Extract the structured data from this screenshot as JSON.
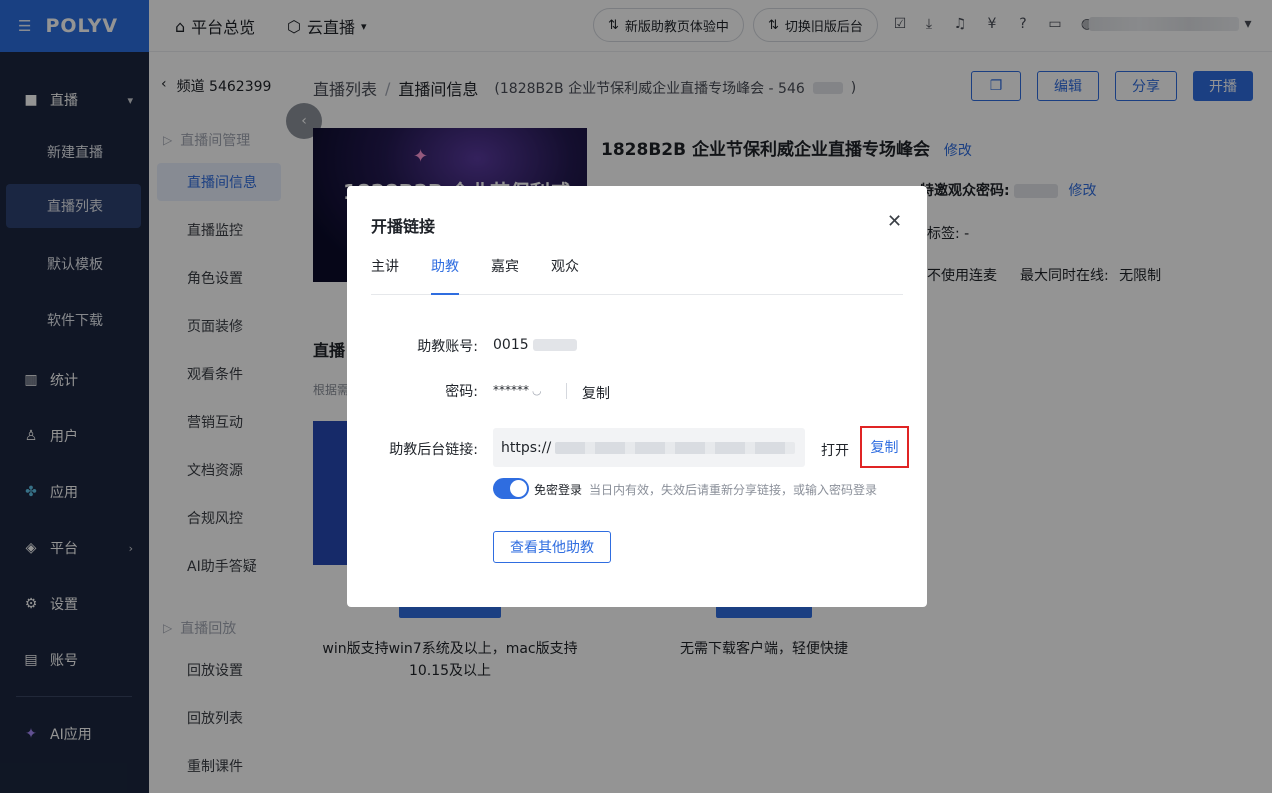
{
  "nav": {
    "logo": "POLYV",
    "items": [
      {
        "label": "直播",
        "icon": "video-icon"
      },
      {
        "label": "统计",
        "icon": "bar-chart-icon"
      },
      {
        "label": "用户",
        "icon": "user-icon"
      },
      {
        "label": "应用",
        "icon": "apps-icon"
      },
      {
        "label": "平台",
        "icon": "layers-icon"
      },
      {
        "label": "设置",
        "icon": "gear-icon"
      },
      {
        "label": "账号",
        "icon": "id-card-icon"
      },
      {
        "label": "AI应用",
        "icon": "sparkle-icon"
      }
    ],
    "sub_items": [
      "新建直播",
      "直播列表",
      "默认模板",
      "软件下载"
    ],
    "active_sub": "直播列表"
  },
  "subnav": {
    "channel": "频道 5462399",
    "group1": "直播间管理",
    "group1_items": [
      "直播间信息",
      "直播监控",
      "角色设置",
      "页面装修",
      "观看条件",
      "营销互动",
      "文档资源",
      "合规风控",
      "AI助手答疑"
    ],
    "group2": "直播回放",
    "group2_items": [
      "回放设置",
      "回放列表",
      "重制课件"
    ]
  },
  "header": {
    "overview": "平台总览",
    "cloud_live": "云直播",
    "btn_new_assistant": "新版助教页体验中",
    "btn_switch_old": "切换旧版后台"
  },
  "breadcrumb": {
    "list": "直播列表",
    "sep": "/",
    "current": "直播间信息",
    "sub": "(1828B2B 企业节保利威企业直播专场峰会 - 546"
  },
  "actions": {
    "edit": "编辑",
    "share": "分享",
    "start": "开播"
  },
  "event": {
    "title": "1828B2B 企业节保利威企业直播专场峰会",
    "modify": "修改",
    "cover_text": "1828B2B 企业节保利威",
    "invite_pwd_label": "特邀观众密码:",
    "invite_modify": "修改",
    "tag_label": "标签: -",
    "mic_text": "不使用连麦",
    "max_online_label": "最大同时在线:",
    "max_online_value": "无限制"
  },
  "section": {
    "title": "直播",
    "desc": "根据需",
    "win_note": "win版支持win7系统及以上，mac版支持10.15及以上",
    "web_note": "无需下载客户端，轻便快捷"
  },
  "modal": {
    "title": "开播链接",
    "tabs": [
      "主讲",
      "助教",
      "嘉宾",
      "观众"
    ],
    "active_tab": "助教",
    "account_label": "助教账号:",
    "account_value": "0015",
    "password_label": "密码:",
    "password_value": "******",
    "copy": "复制",
    "link_label": "助教后台链接:",
    "link_value": "https://",
    "open": "打开",
    "copy_link": "复制",
    "toggle_label": "免密登录",
    "toggle_hint": "当日内有效，失效后请重新分享链接，或输入密码登录",
    "other_btn": "查看其他助教"
  },
  "colors": {
    "primary": "#2f6de0",
    "nav_bg": "#1c2740",
    "highlight": "#e02424"
  }
}
